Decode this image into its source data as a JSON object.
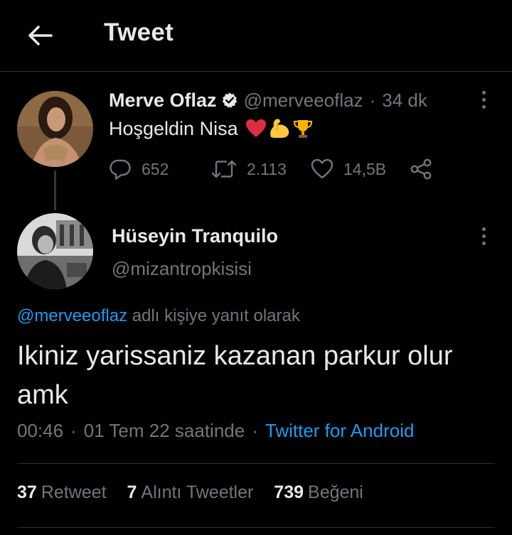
{
  "header": {
    "title": "Tweet",
    "back_icon": "arrow-left-icon"
  },
  "parent_tweet": {
    "display_name": "Merve Oflaz",
    "handle": "@merveeoflaz",
    "separator": "·",
    "time": "34 dk",
    "text": "Hoşgeldin Nisa",
    "emojis": [
      "red-heart-icon",
      "flexed-biceps-icon",
      "trophy-icon"
    ],
    "actions": {
      "reply_count": "652",
      "retweet_count": "2.113",
      "like_count": "14,5B"
    }
  },
  "main_tweet": {
    "display_name": "Hüseyin Tranquilo",
    "handle": "@mizantropkisisi",
    "reply_to_handle": "@merveeoflaz",
    "reply_to_suffix": " adlı kişiye yanıt olarak",
    "text": "Ikiniz yarissaniz kazanan parkur olur amk",
    "meta": {
      "time": "00:46",
      "date": "01 Tem 22 saatinde",
      "separator": "·",
      "source": "Twitter for Android"
    },
    "stats": {
      "retweets_count": "37",
      "retweets_label": "Retweet",
      "quotes_count": "7",
      "quotes_label": "Alıntı Tweetler",
      "likes_count": "739",
      "likes_label": "Beğeni"
    }
  },
  "colors": {
    "background": "#000000",
    "text_primary": "#e7e9ea",
    "text_secondary": "#71767b",
    "accent": "#1d9bf0",
    "divider": "#2f3336"
  }
}
